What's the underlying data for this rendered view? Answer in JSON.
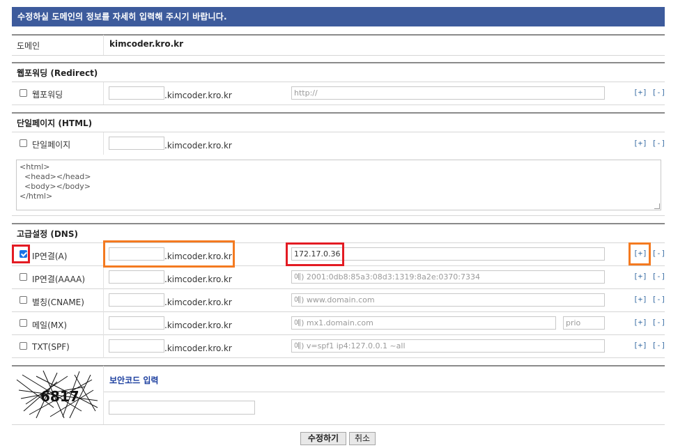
{
  "header": {
    "title": "수정하실 도메인의 정보를 자세히 입력해 주시기 바랍니다."
  },
  "domain": {
    "label": "도메인",
    "value": "kimcoder.kro.kr"
  },
  "suffix": ".kimcoder.kro.kr",
  "add_label": "[+]",
  "remove_label": "[-]",
  "redirect": {
    "title": "웹포워딩 (Redirect)",
    "row_label": "웹포워딩",
    "url_placeholder": "http://"
  },
  "html_page": {
    "title": "단일페이지 (HTML)",
    "row_label": "단일페이지",
    "content": "<html>\n  <head></head>\n  <body></body>\n</html>"
  },
  "dns": {
    "title": "고급설정 (DNS)",
    "rows": [
      {
        "label": "IP연결(A)",
        "checked": true,
        "value": "172.17.0.36",
        "placeholder": ""
      },
      {
        "label": "IP연결(AAAA)",
        "checked": false,
        "value": "",
        "placeholder": "예) 2001:0db8:85a3:08d3:1319:8a2e:0370:7334"
      },
      {
        "label": "별칭(CNAME)",
        "checked": false,
        "value": "",
        "placeholder": "예) www.domain.com"
      },
      {
        "label": "메일(MX)",
        "checked": false,
        "value": "",
        "placeholder": "예) mx1.domain.com",
        "prio_placeholder": "prio"
      },
      {
        "label": "TXT(SPF)",
        "checked": false,
        "value": "",
        "placeholder": "예) v=spf1 ip4:127.0.0.1 ~all"
      }
    ]
  },
  "security": {
    "title": "보안코드 입력",
    "captcha_text": "6817"
  },
  "buttons": {
    "submit": "수정하기",
    "cancel": "취소"
  },
  "colors": {
    "header_bg": "#3d5b9c",
    "highlight_red": "#e31b23",
    "highlight_orange": "#f47a20",
    "link": "#3a6ea5",
    "security_title": "#1a3d9e"
  }
}
